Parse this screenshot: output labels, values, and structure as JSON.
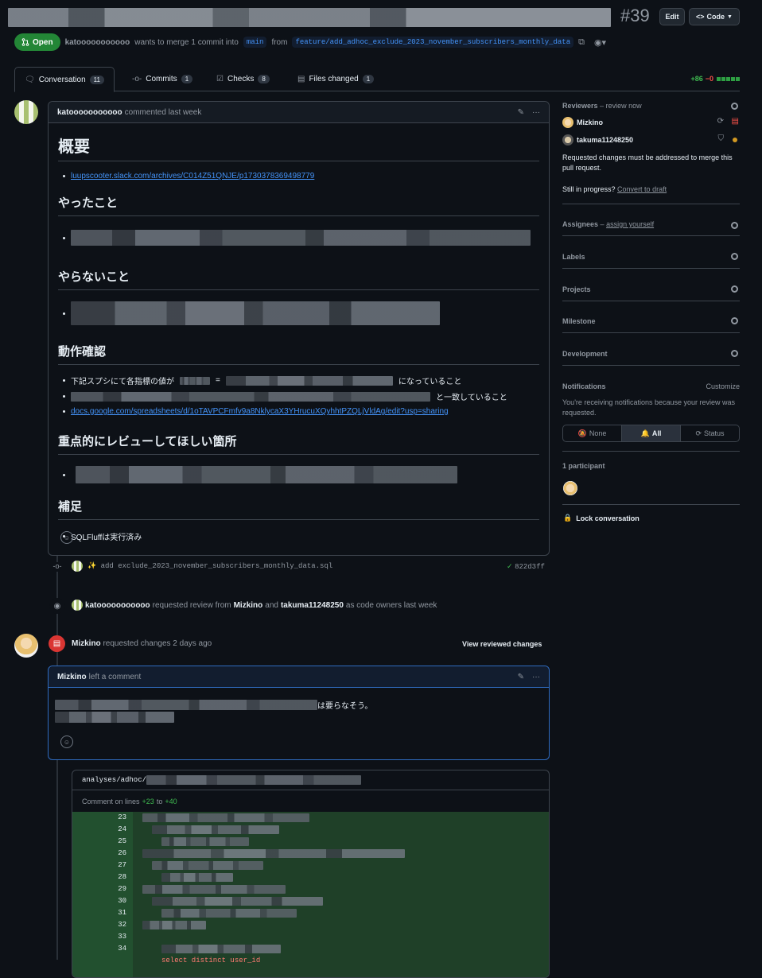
{
  "header": {
    "pr_number": "#39",
    "edit_label": "Edit",
    "code_label": "Code"
  },
  "state": {
    "status": "Open",
    "author": "katooooooooooo",
    "merge_text_1": "wants to merge 1 commit into",
    "base_branch": "main",
    "from_text": "from",
    "head_branch": "feature/add_adhoc_exclude_2023_november_subscribers_monthly_data"
  },
  "tabs": [
    {
      "label": "Conversation",
      "count": "11"
    },
    {
      "label": "Commits",
      "count": "1"
    },
    {
      "label": "Checks",
      "count": "8"
    },
    {
      "label": "Files changed",
      "count": "1"
    }
  ],
  "diffstat": {
    "additions": "+86",
    "deletions": "−0"
  },
  "first_comment": {
    "author": "katooooooooooo",
    "meta": "commented last week",
    "h_overview": "概要",
    "link1": "luupscooter.slack.com/archives/C014Z51QNJE/p1730378369498779",
    "h_done": "やったこと",
    "h_not_done": "やらないこと",
    "h_verify": "動作確認",
    "verify_1_a": "下記スプシにて各指標の値が",
    "verify_1_eq": "=",
    "verify_1_b": "になっていること",
    "verify_2_b": "と一致していること",
    "link2": "docs.google.com/spreadsheets/d/1oTAVPCFmfv9a8NklycaX3YHrucuXQyhhtPZQLjVldAg/edit?usp=sharing",
    "h_review": "重点的にレビューしてほしい箇所",
    "h_note": "補足",
    "note_1": "SQLFluffは実行済み"
  },
  "commit_event": {
    "message": "✨ add exclude_2023_november_subscribers_monthly_data.sql",
    "sha": "822d3ff"
  },
  "review_request": {
    "author": "katooooooooooo",
    "text1": "requested review from",
    "reviewer1": "Mizkino",
    "and": "and",
    "reviewer2": "takuma11248250",
    "text2": "as code owners last week"
  },
  "review": {
    "author": "Mizkino",
    "text": "requested changes 2 days ago",
    "view_changes": "View reviewed changes",
    "comment_author": "Mizkino",
    "comment_meta": "left a comment",
    "comment_text_tail": "は要らなそう。",
    "file_path_prefix": "analyses/adhoc/",
    "lines_label": "Comment on lines",
    "line_from": "+23",
    "to": "to",
    "line_to": "+40"
  },
  "code_lines": [
    "23",
    "24",
    "25",
    "26",
    "27",
    "28",
    "29",
    "30",
    "31",
    "32",
    "33",
    "34"
  ],
  "code_partial": "select distinct user_id",
  "sidebar": {
    "reviewers_title": "Reviewers",
    "reviewers_link": "review now",
    "reviewer1": "Mizkino",
    "reviewer2": "takuma11248250",
    "changes_note": "Requested changes must be addressed to merge this pull request.",
    "still_progress": "Still in progress?",
    "convert_draft": "Convert to draft",
    "assignees_title": "Assignees",
    "assign_yourself": "assign yourself",
    "labels_title": "Labels",
    "projects_title": "Projects",
    "milestone_title": "Milestone",
    "development_title": "Development",
    "notifications_title": "Notifications",
    "customize": "Customize",
    "notif_text": "You're receiving notifications because your review was requested.",
    "notif_none": "None",
    "notif_all": "All",
    "notif_status": "Status",
    "participants": "1 participant",
    "lock": "Lock conversation"
  }
}
